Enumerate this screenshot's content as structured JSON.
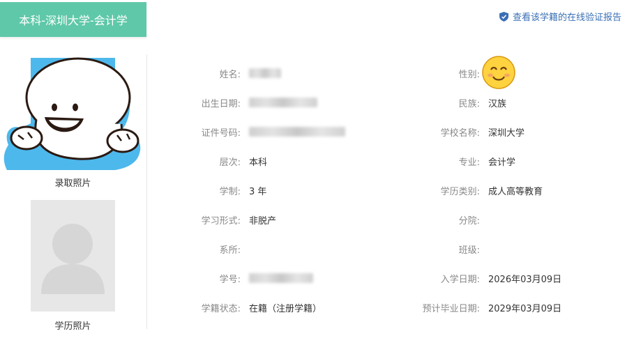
{
  "header": {
    "tab_title": "本科-深圳大学-会计学",
    "verify_link": "查看该学籍的在线验证报告"
  },
  "photos": {
    "admission_label": "录取照片",
    "education_label": "学历照片"
  },
  "fields": {
    "name_label": "姓名:",
    "name_value": "",
    "birth_label": "出生日期:",
    "birth_value": "",
    "id_label": "证件号码:",
    "id_value": "",
    "level_label": "层次:",
    "level_value": "本科",
    "duration_label": "学制:",
    "duration_value": "3 年",
    "study_form_label": "学习形式:",
    "study_form_value": "非脱产",
    "department_label": "系所:",
    "department_value": "",
    "student_no_label": "学号:",
    "student_no_value": "",
    "status_label": "学籍状态:",
    "status_value": "在籍（注册学籍）",
    "gender_label": "性别:",
    "gender_value": "",
    "ethnicity_label": "民族:",
    "ethnicity_value": "汉族",
    "school_label": "学校名称:",
    "school_value": "深圳大学",
    "major_label": "专业:",
    "major_value": "会计学",
    "edu_type_label": "学历类别:",
    "edu_type_value": "成人高等教育",
    "branch_label": "分院:",
    "branch_value": "",
    "class_label": "班级:",
    "class_value": "",
    "enroll_date_label": "入学日期:",
    "enroll_date_value": "2026年03月09日",
    "grad_date_label": "预计毕业日期:",
    "grad_date_value": "2029年03月09日"
  },
  "colors": {
    "tab_bg": "#5fc8a8",
    "link": "#3a6fb5",
    "admission_photo_bg": "#4db8ec",
    "education_photo_bg": "#e7e7e7"
  }
}
